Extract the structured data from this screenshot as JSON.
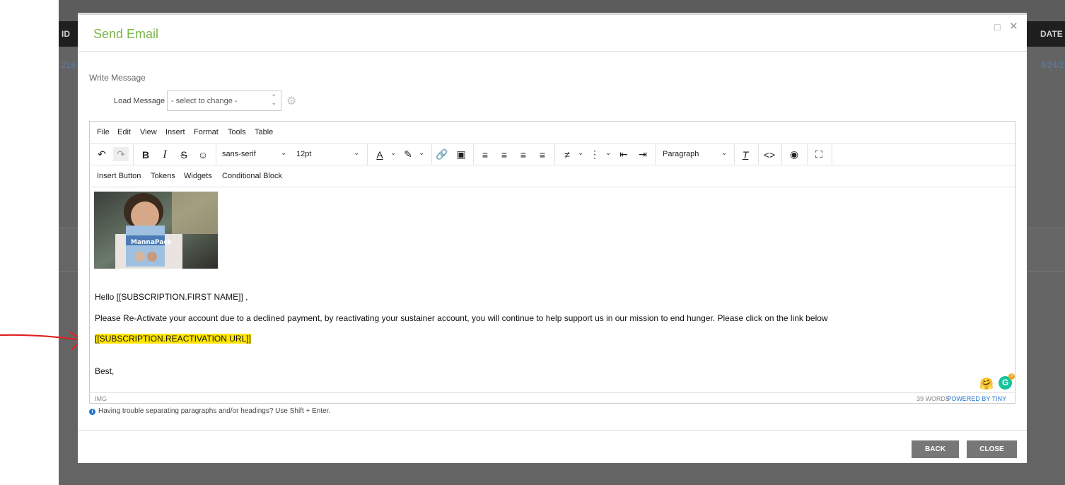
{
  "background": {
    "header_left": "ID",
    "header_right": "DATE",
    "row_id": "216",
    "row_date": "4/24/2"
  },
  "modal": {
    "title": "Send Email",
    "section_label": "Write Message",
    "load_message_label": "Load Message",
    "load_select_value": "- select to change -"
  },
  "editor": {
    "menu": [
      "File",
      "Edit",
      "View",
      "Insert",
      "Format",
      "Tools",
      "Table"
    ],
    "font_family": "sans-serif",
    "font_size": "12pt",
    "block_format": "Paragraph",
    "extra_menu": [
      "Insert Button",
      "Tokens",
      "Widgets",
      "Conditional Block"
    ],
    "content": {
      "greeting": "Hello [[SUBSCRIPTION.FIRST NAME]] ,",
      "body": "Please Re-Activate your account due to a declined payment, by reactivating your sustainer account, you will continue to help support us in our mission to end hunger. Please click on the link below",
      "url_token": "[[SUBSCRIPTION.REACTIVATION URL]]",
      "signoff": "Best,"
    },
    "status": {
      "element_path": "IMG",
      "word_count": "39 WORDS",
      "powered_by": "POWERED BY TINY"
    },
    "grammarly_count": "3"
  },
  "hint": "Having trouble separating paragraphs and/or headings? Use Shift + Enter.",
  "buttons": {
    "back": "BACK",
    "close": "CLOSE"
  },
  "colors": {
    "title_green": "#7ab648",
    "highlight": "#ffe500",
    "button_gray": "#777777",
    "annotation_red": "#e02020"
  }
}
